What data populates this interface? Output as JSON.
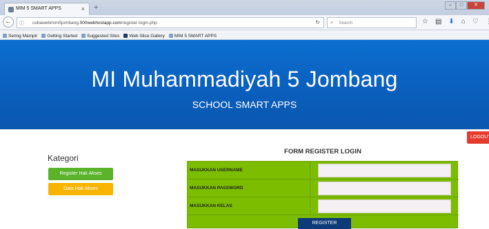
{
  "browser": {
    "tab_title": "MIM 5 SMART APPS",
    "tab_close": "×",
    "new_tab": "+",
    "url_prefix": "cobawebmim5jombang.",
    "url_domain": "000webhostapp.com",
    "url_path": "/register-login.php",
    "search_placeholder": "Search",
    "bookmarks": [
      "Sering Mampir",
      "Getting Started",
      "Suggested Sites",
      "Web Slice Gallery",
      "MIM 5 SMART APPS"
    ]
  },
  "hero": {
    "title": "MI Muhammadiyah 5 Jombang",
    "subtitle": "SCHOOL SMART APPS"
  },
  "logout_label": "LOGOUT",
  "sidebar": {
    "title": "Kategori",
    "buttons": [
      "Register Hak Akses",
      "Data Hak Akses"
    ]
  },
  "form": {
    "title": "FORM REGISTER LOGIN",
    "fields": [
      {
        "label": "MASUKKAN USERNAME",
        "value": ""
      },
      {
        "label": "MASUKKAN PASSWORD",
        "value": ""
      },
      {
        "label": "MASUKKAN KELAS",
        "value": ""
      }
    ],
    "submit_label": "REGISTER"
  },
  "colors": {
    "hero_blue": "#0b63c8",
    "form_green": "#7cbd00",
    "logout_red": "#e53b2f",
    "register_navy": "#0d3a78",
    "side_green": "#5ab329",
    "side_yellow": "#f7b500"
  }
}
